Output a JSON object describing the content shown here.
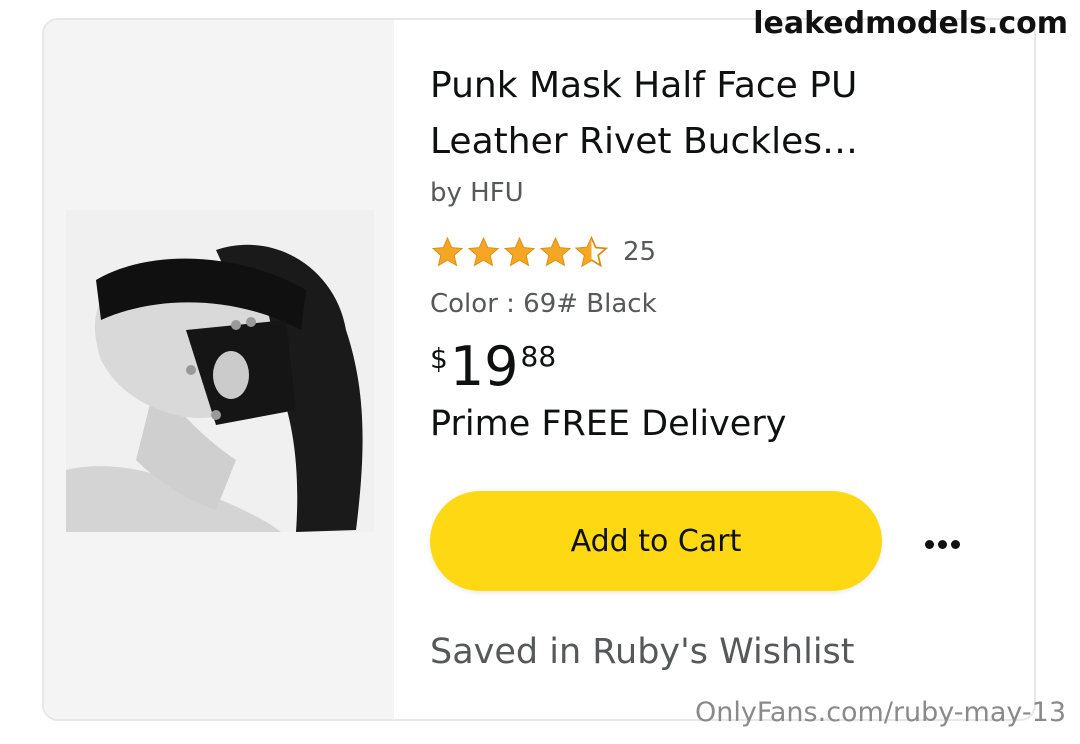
{
  "watermarks": {
    "top": "leakedmodels.com",
    "bottom": "OnlyFans.com/ruby-may-13"
  },
  "product": {
    "title": "Punk Mask Half Face PU Leather Rivet Buckles…",
    "byline": "by HFU",
    "rating": {
      "stars": 4.5,
      "max": 5,
      "count": "25"
    },
    "color": "Color : 69# Black",
    "price": {
      "symbol": "$",
      "whole": "19",
      "fraction": "88"
    },
    "delivery": "Prime FREE Delivery",
    "image_icon": "product-photo"
  },
  "actions": {
    "add_to_cart_label": "Add to Cart",
    "more_icon": "more-horizontal-icon"
  },
  "status": {
    "saved_text": "Saved in Ruby's Wishlist"
  },
  "colors": {
    "star": "#f5a623",
    "button": "#ffd814",
    "muted_text": "#565959"
  }
}
